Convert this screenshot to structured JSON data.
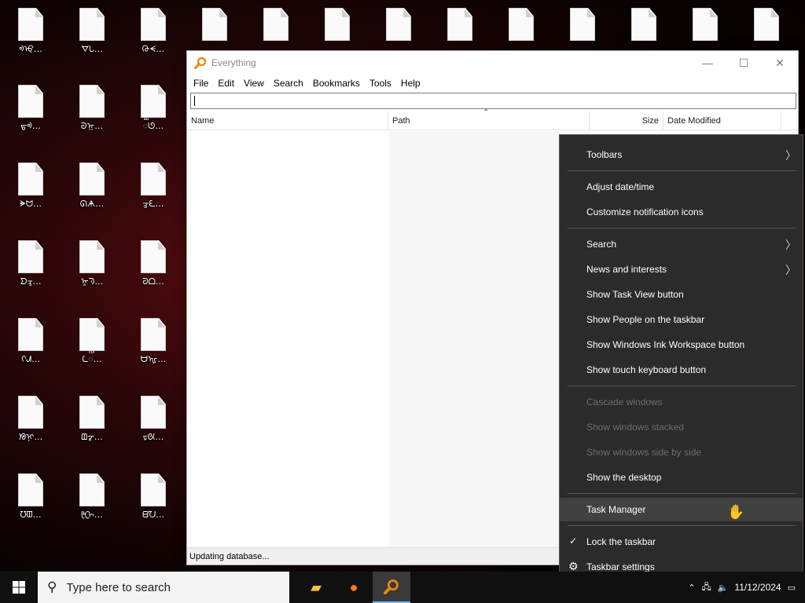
{
  "desktop_icons": [
    {
      "label": "ᢀ⁠ᡇ…"
    },
    {
      "label": "ᗊᘂ…"
    },
    {
      "label": "ᢙᗕ…"
    },
    {
      "label": "ᡖᢀ…"
    },
    {
      "label": "ᘐᡍ…"
    },
    {
      "label": "ᢆᘎ…"
    },
    {
      "label": "ᗙᗢ…"
    },
    {
      "label": "ᘏᗗ…"
    },
    {
      "label": "ᡜᘍ…"
    },
    {
      "label": "ᗤᢋ…"
    },
    {
      "label": "ᡎᘅ…"
    },
    {
      "label": "ᘒᗝ…"
    },
    {
      "label": "ᢉᗂ…"
    },
    {
      "label": "ᘇᢅ…"
    },
    {
      "label": "ᗨᡙ…"
    },
    {
      "label": "ᘠᢊ…"
    },
    {
      "label": "ᗶᡒ…"
    },
    {
      "label": "ᢑᘡ…"
    },
    {
      "label": "ᘮᗵ…"
    },
    {
      "label": "ᡛᢕ…"
    },
    {
      "label": "ᗺᘨ…"
    }
  ],
  "window": {
    "title": "Everything",
    "menu": [
      "File",
      "Edit",
      "View",
      "Search",
      "Bookmarks",
      "Tools",
      "Help"
    ],
    "search_value": "",
    "columns": {
      "name": "Name",
      "path": "Path",
      "size": "Size",
      "date": "Date Modified"
    },
    "status": "Updating database..."
  },
  "context_menu": {
    "toolbars": "Toolbars",
    "adjust_datetime": "Adjust date/time",
    "customize_notif": "Customize notification icons",
    "search": "Search",
    "news": "News and interests",
    "task_view": "Show Task View button",
    "people": "Show People on the taskbar",
    "ink": "Show Windows Ink Workspace button",
    "touch_kb": "Show touch keyboard button",
    "cascade": "Cascade windows",
    "stacked": "Show windows stacked",
    "side_by_side": "Show windows side by side",
    "show_desktop": "Show the desktop",
    "task_manager": "Task Manager",
    "lock_taskbar": "Lock the taskbar",
    "taskbar_settings": "Taskbar settings"
  },
  "taskbar": {
    "search_placeholder": "Type here to search",
    "date": "11/12/2024"
  },
  "colors": {
    "accent": "#76b9ed",
    "menu_bg": "#2b2b2b",
    "disabled_text": "#6d6d6d"
  }
}
